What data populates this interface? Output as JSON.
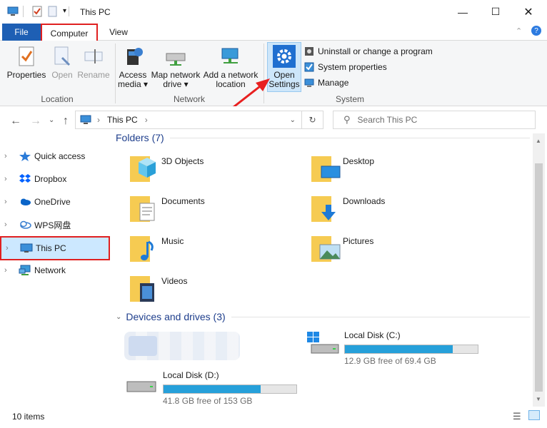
{
  "window": {
    "title": "This PC"
  },
  "tabs": {
    "file": "File",
    "computer": "Computer",
    "view": "View"
  },
  "ribbon": {
    "location": {
      "label": "Location",
      "properties": "Properties",
      "open": "Open",
      "rename": "Rename"
    },
    "network": {
      "label": "Network",
      "access_media_1": "Access",
      "access_media_2": "media ▾",
      "map_drive_1": "Map network",
      "map_drive_2": "drive ▾",
      "add_location_1": "Add a network",
      "add_location_2": "location"
    },
    "system": {
      "label": "System",
      "open_settings_1": "Open",
      "open_settings_2": "Settings",
      "uninstall": "Uninstall or change a program",
      "system_properties": "System properties",
      "manage": "Manage"
    }
  },
  "address": {
    "crumb": "This PC",
    "search_placeholder": "Search This PC"
  },
  "nav": {
    "items": [
      {
        "label": "Quick access"
      },
      {
        "label": "Dropbox"
      },
      {
        "label": "OneDrive"
      },
      {
        "label": "WPS网盘"
      },
      {
        "label": "This PC"
      },
      {
        "label": "Network"
      }
    ]
  },
  "content": {
    "folders_header": "Folders (7)",
    "folders": [
      {
        "name": "3D Objects"
      },
      {
        "name": "Desktop"
      },
      {
        "name": "Documents"
      },
      {
        "name": "Downloads"
      },
      {
        "name": "Music"
      },
      {
        "name": "Pictures"
      },
      {
        "name": "Videos"
      }
    ],
    "devices_header": "Devices and drives (3)",
    "drives": [
      {
        "name": "Local Disk (C:)",
        "free": "12.9 GB free of 69.4 GB",
        "used_fraction": 0.81
      },
      {
        "name": "Local Disk (D:)",
        "free": "41.8 GB free of 153 GB",
        "used_fraction": 0.73
      }
    ]
  },
  "status": {
    "count": "10 items"
  },
  "colors": {
    "accent": "#1e5fb4",
    "highlight_box": "#e02020",
    "selected_bg": "#cce8ff",
    "drive_bar": "#26a0da"
  }
}
